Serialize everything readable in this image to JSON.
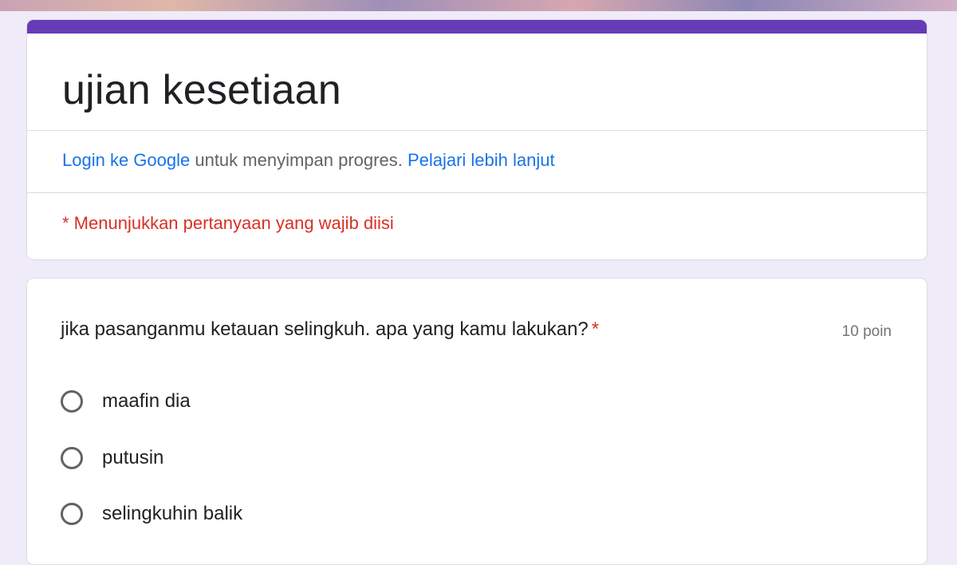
{
  "form": {
    "title": "ujian kesetiaan",
    "theme_color": "#673ab7",
    "background_color": "#f0ebf8"
  },
  "login_notice": {
    "login_link": "Login ke Google",
    "middle_text": " untuk menyimpan progres. ",
    "learn_more_link": "Pelajari lebih lanjut",
    "link_color": "#1a73e8"
  },
  "required_note": "* Menunjukkan pertanyaan yang wajib diisi",
  "question": {
    "text": "jika pasanganmu ketauan selingkuh. apa yang kamu lakukan?",
    "required_mark": "*",
    "points": "10 poin",
    "options": [
      {
        "label": "maafin dia",
        "selected": false
      },
      {
        "label": "putusin",
        "selected": false
      },
      {
        "label": "selingkuhin balik",
        "selected": false
      }
    ]
  }
}
